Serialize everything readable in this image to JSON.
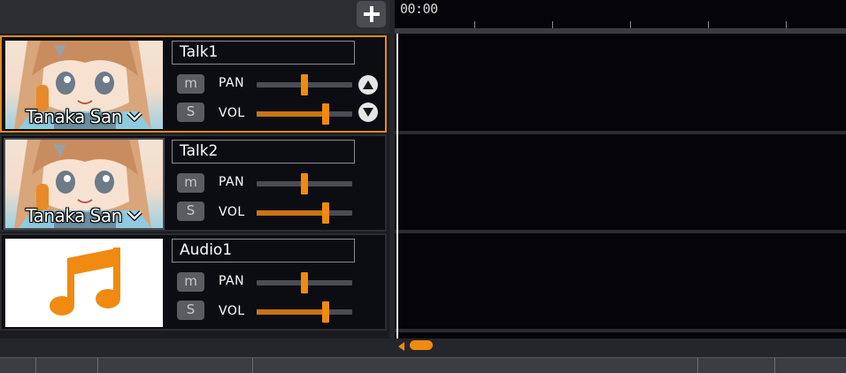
{
  "header": {
    "add_label": "+"
  },
  "ruler": {
    "time": "00:00"
  },
  "tracks": [
    {
      "name": "Talk1",
      "character": "Tanaka San",
      "pan_label": "PAN",
      "vol_label": "VOL",
      "mute_label": "m",
      "solo_label": "S",
      "pan_value": 0.5,
      "vol_value": 0.72,
      "selected": true
    },
    {
      "name": "Talk2",
      "character": "Tanaka San",
      "pan_label": "PAN",
      "vol_label": "VOL",
      "mute_label": "m",
      "solo_label": "S",
      "pan_value": 0.5,
      "vol_value": 0.72,
      "selected": false
    },
    {
      "name": "Audio1",
      "pan_label": "PAN",
      "vol_label": "VOL",
      "mute_label": "m",
      "solo_label": "S",
      "pan_value": 0.5,
      "vol_value": 0.72,
      "selected": false
    }
  ],
  "colors": {
    "accent": "#f08a10",
    "selected_border": "#e08a1c",
    "timeline_bg": "#050509"
  },
  "icons": {
    "add": "plus-icon",
    "move_up": "arrow-up-circle-icon",
    "move_down": "arrow-down-circle-icon",
    "audio": "music-note-icon",
    "dropdown": "chevron-down-icon"
  }
}
